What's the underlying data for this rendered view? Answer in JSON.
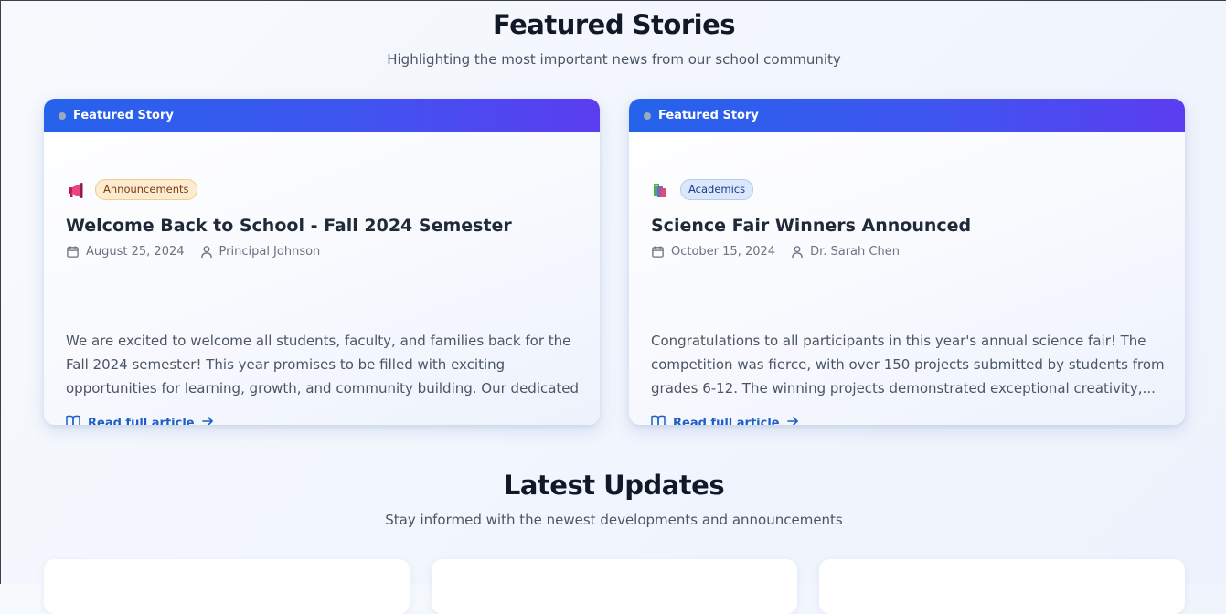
{
  "featured": {
    "title": "Featured Stories",
    "subtitle": "Highlighting the most important news from our school community",
    "cards": [
      {
        "banner_label": "Featured Story",
        "category_icon": "megaphone-icon",
        "category": "Announcements",
        "title": "Welcome Back to School - Fall 2024 Semester",
        "date": "August 25, 2024",
        "author": "Principal Johnson",
        "excerpt": "We are excited to welcome all students, faculty, and families back for the Fall 2024 semester! This year promises to be filled with exciting opportunities for learning, growth, and community building. Our dedicated faculty has been...",
        "link_label": "Read full article"
      },
      {
        "banner_label": "Featured Story",
        "category_icon": "books-icon",
        "category": "Academics",
        "title": "Science Fair Winners Announced",
        "date": "October 15, 2024",
        "author": "Dr. Sarah Chen",
        "excerpt": "Congratulations to all participants in this year's annual science fair! The competition was fierce, with over 150 projects submitted by students from grades 6-12. The winning projects demonstrated exceptional creativity,...",
        "link_label": "Read full article"
      }
    ]
  },
  "latest": {
    "title": "Latest Updates",
    "subtitle": "Stay informed with the newest developments and announcements"
  },
  "colors": {
    "banner_start": "#2563eb",
    "banner_end": "#5b3df0",
    "link": "#1d5fc8",
    "announcements_tag_bg": "#fdebd0",
    "academics_tag_bg": "#dbe7fb"
  }
}
